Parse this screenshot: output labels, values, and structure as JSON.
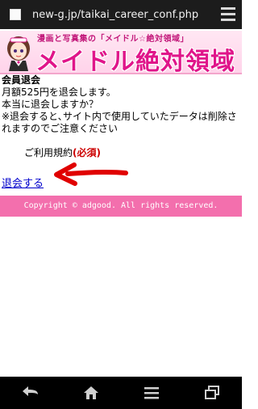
{
  "browser": {
    "url": "new-g.jp/taikai_career_conf.php"
  },
  "banner": {
    "subtitle": "漫画と写真集の「メイドル☆絶対領域」",
    "title": "メイドル絶対領域"
  },
  "content": {
    "heading": "会員退会",
    "line1": "月額525円を退会します。",
    "line2": "本当に退会しますか？",
    "line3": "※退会すると､サイト内で使用していたデータは削除されますのでご注意ください"
  },
  "terms": {
    "label": "ご利用規約",
    "required": "(必須)"
  },
  "withdraw_link": "退会する",
  "footer": {
    "copyright": "Copyright © adgood. All rights reserved."
  },
  "colors": {
    "accent_pink": "#f36fad",
    "banner_text": "#e0158a",
    "link_blue": "#0000cc",
    "arrow_red": "#e00000"
  },
  "icons": {
    "menu": "menu-icon",
    "back": "back-icon",
    "home": "home-icon",
    "list": "list-icon",
    "windows": "windows-icon"
  }
}
